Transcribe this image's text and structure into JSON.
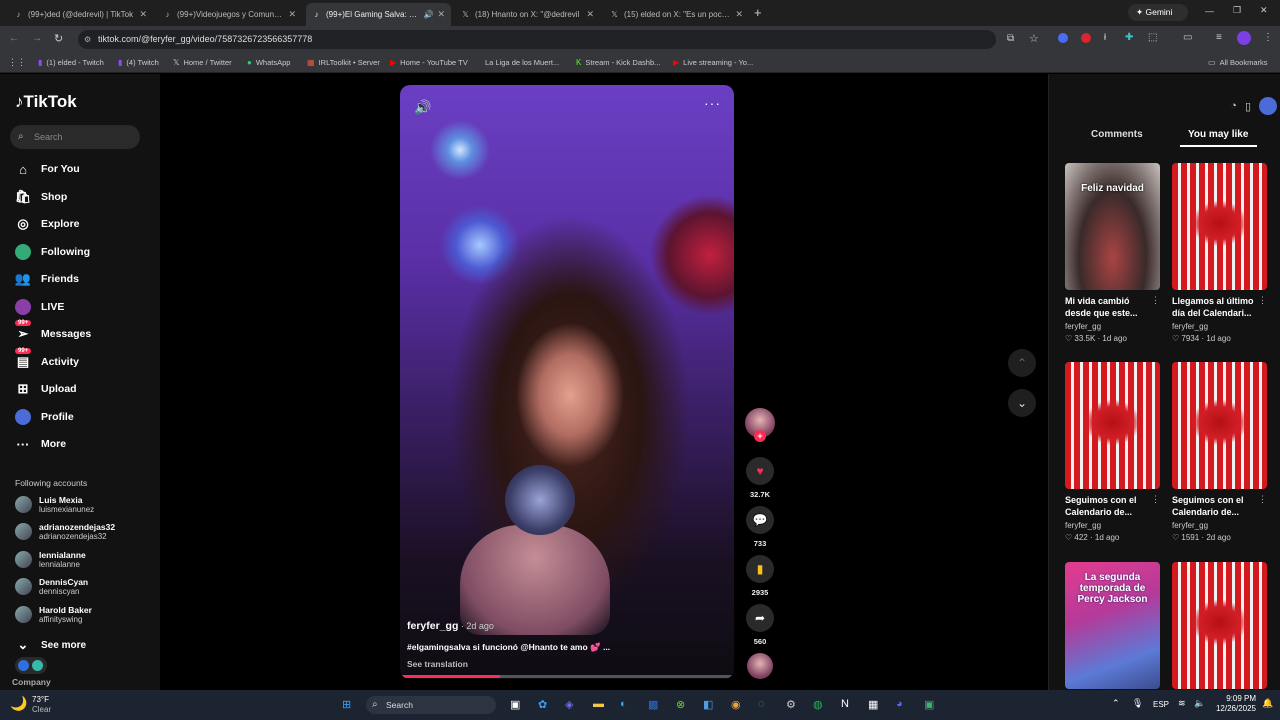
{
  "browser": {
    "tabs": [
      {
        "title": "(99+)ded (@dedrevil) | TikTok",
        "icon": "tiktok-icon"
      },
      {
        "title": "(99+)Videojuegos y Comunidad",
        "icon": "tiktok-icon"
      },
      {
        "title": "(99+)El Gaming Salva: Imp",
        "icon": "tiktok-icon"
      },
      {
        "title": "(18) Hnanto on X: \"@dedrevil",
        "icon": "x-icon"
      },
      {
        "title": "(15) elded on X: \"Es un poco d",
        "icon": "x-icon"
      }
    ],
    "gemini_label": "Gemini",
    "url": "tiktok.com/@feryfer_gg/video/7587326723566357778",
    "bookmarks": [
      "(1) elded - Twitch",
      "(4) Twitch",
      "Home / Twitter",
      "WhatsApp",
      "IRLToolkit • Server",
      "Home - YouTube TV",
      "La Liga de los Muert...",
      "Stream - Kick Dashb...",
      "Live streaming - Yo..."
    ],
    "all_bookmarks": "All Bookmarks"
  },
  "sidebar": {
    "logo": "TikTok",
    "search_placeholder": "Search",
    "nav": [
      {
        "label": "For You",
        "icon": "home-icon"
      },
      {
        "label": "Shop",
        "icon": "shop-icon"
      },
      {
        "label": "Explore",
        "icon": "compass-icon"
      },
      {
        "label": "Following",
        "icon": "following-icon"
      },
      {
        "label": "Friends",
        "icon": "friends-icon"
      },
      {
        "label": "LIVE",
        "icon": "live-icon"
      },
      {
        "label": "Messages",
        "icon": "messages-icon",
        "badge": "99+"
      },
      {
        "label": "Activity",
        "icon": "activity-icon",
        "badge": "99+"
      },
      {
        "label": "Upload",
        "icon": "upload-icon"
      },
      {
        "label": "Profile",
        "icon": "profile-icon"
      },
      {
        "label": "More",
        "icon": "more-icon"
      }
    ],
    "following_title": "Following accounts",
    "accounts": [
      {
        "name": "Luis Mexia",
        "user": "luismexianunez"
      },
      {
        "name": "adrianozendejas32",
        "user": "adrianozendejas32"
      },
      {
        "name": "lennialanne",
        "user": "lennialanne"
      },
      {
        "name": "DennisCyan",
        "user": "denniscyan"
      },
      {
        "name": "Harold Baker",
        "user": "affinityswing"
      }
    ],
    "see_more": "See more",
    "company": "Company"
  },
  "video": {
    "author": "feryfer_gg",
    "age": " · 2d ago",
    "caption": "#elgamingsalva si funcionó @Hnanto te amo 💕 ...",
    "see_translation": "See translation",
    "progress": 0.3,
    "likes": "32.7K",
    "comments": "733",
    "saves": "2935",
    "shares": "560"
  },
  "right_panel": {
    "tabs": [
      "Comments",
      "You may like"
    ],
    "cards": [
      {
        "title": "Mi vida cambió desde que este...",
        "user": "feryfer_gg",
        "likes": "33.5K",
        "age": "1d ago",
        "overlay": "Feliz navidad"
      },
      {
        "title": "Llegamos al último día del Calendari...",
        "user": "feryfer_gg",
        "likes": "7934",
        "age": "1d ago"
      },
      {
        "title": "Seguimos con el Calendario de...",
        "user": "feryfer_gg",
        "likes": "422",
        "age": "1d ago"
      },
      {
        "title": "Seguimos con el Calendario de...",
        "user": "feryfer_gg",
        "likes": "1591",
        "age": "2d ago"
      },
      {
        "overlay": "La segunda temporada de Percy Jackson"
      },
      {}
    ]
  },
  "taskbar": {
    "weather_temp": "73°F",
    "weather_desc": "Clear",
    "search_label": "Search",
    "lang": "ESP",
    "time": "9:09 PM",
    "date": "12/26/2025"
  },
  "colors": {
    "accent": "#fe2c55",
    "bg": "#121212"
  }
}
